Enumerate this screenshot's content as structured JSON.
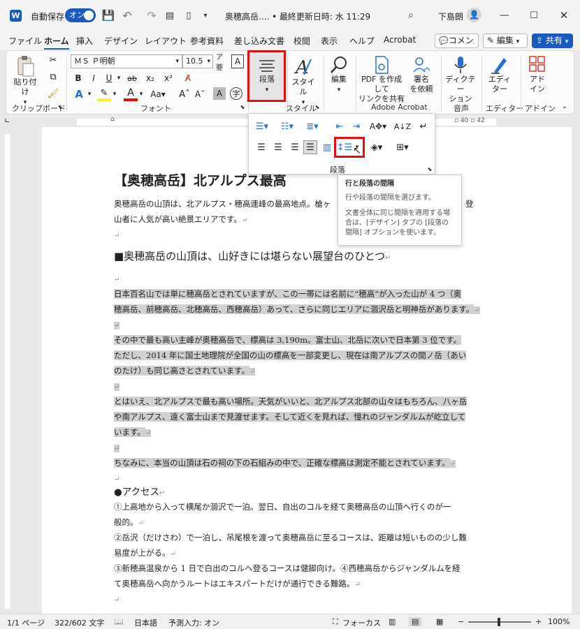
{
  "titlebar": {
    "autosave_label": "自動保存",
    "autosave_state": "オン",
    "doc_title": "奥穂高岳.…",
    "last_saved": "• 最終更新日時: 水 11:29",
    "user_name": "下島朗"
  },
  "menu": {
    "items": [
      "ファイル",
      "ホーム",
      "挿入",
      "デザイン",
      "レイアウト",
      "参考資料",
      "差し込み文書",
      "校閲",
      "表示",
      "ヘルプ",
      "Acrobat"
    ],
    "comment_label": "コメント",
    "edit_label": "編集",
    "share_label": "共有"
  },
  "ribbon": {
    "paste_label": "貼り付け",
    "clipboard_label": "クリップボード",
    "font_name": "ＭＳ Ｐ明朝",
    "font_size": "10.5",
    "font_label": "フォント",
    "paragraph_btn_label": "段落",
    "style_btn_label": "スタイル",
    "style_label": "スタイル",
    "edit_btn_label": "編集",
    "pdf_create_label": "PDF を作成して\nリンクを共有",
    "sign_label": "署名\nを依頼",
    "acrobat_label": "Adobe Acrobat",
    "dictate_label": "ディクテー\nション",
    "voice_label": "音声",
    "editor_btn_label": "エディ\nター",
    "editor_label": "エディター",
    "addin_btn_label": "アド\nイン",
    "addin_label": "アドイン"
  },
  "popup": {
    "label": "段落"
  },
  "tooltip": {
    "title": "行と段落の間隔",
    "line1": "行や段落の間隔を選びます。",
    "line2": "文書全体に同じ間隔を適用する場合は、[デザイン] タブの [段落の間隔] オプションを使います。"
  },
  "doc": {
    "title": "【奥穂高岳】北アルプス最高",
    "intro1": "奥穂高岳の山頂は、北アルプス・穂高連峰の最高地点。槍ヶ",
    "intro1_end": "登",
    "intro2": "山者に人気が高い絶景エリアです。",
    "heading1": "■奥穂高岳の山頂は、山好きには堪らない展望台のひとつ",
    "p1a": "日本百名山では単に穂高岳とされていますが、この一帯には名前に“穂高”が入った山が 4 つ（奥",
    "p1b": "穂高岳、前穂高岳、北穂高岳、西穂高岳）あって、さらに同じエリアに涸沢岳と明神岳があります。",
    "p2a": "その中で最も高い主峰が奥穂高岳で、標高は 3,190m。富士山、北岳に次いで日本第 3 位です。",
    "p2b": "ただし、2014 年に国土地理院が全国の山の標高を一部変更し、現在は南アルプスの間ノ岳（あい",
    "p2c": "のたけ）も同じ高さとされています。",
    "p3a": "とはいえ、北アルプスで最も高い場所。天気がいいと、北アルプス北部の山々はもちろん、八ヶ岳",
    "p3b": "や南アルプス、遠く富士山まで見渡せます。そして近くを見れば、憧れのジャンダルムが屹立して",
    "p3c": "います。",
    "p4": "ちなみに、本当の山頂は石の祠の下の石組みの中で、正確な標高は測定不能とされています。",
    "heading2": "●アクセス",
    "a1a": "①上高地から入って横尾か涸沢で一泊。翌日、自出のコルを経て奥穂高岳の山頂へ行くのが一",
    "a1b": "般的。",
    "a2a": "②岳沢（だけさわ）で一泊し、吊尾根を渡って奥穂高岳に至るコースは、距離は短いものの少し難",
    "a2b": "易度が上がる。",
    "a3a": "③新穂高温泉から 1 日で白出のコルへ登るコースは健脚向け。④西穂高岳からジャンダルムを経",
    "a3b": "て奥穂高岳へ向かうルートはエキスパートだけが通行できる難路。"
  },
  "status": {
    "page": "1/1 ページ",
    "words": "322/602 文字",
    "lang": "日本語",
    "predict": "予測入力: オン",
    "focus": "フォーカス",
    "zoom": "100%"
  },
  "colors": {
    "accent": "#185abd",
    "highlight_red": "#e01010"
  }
}
